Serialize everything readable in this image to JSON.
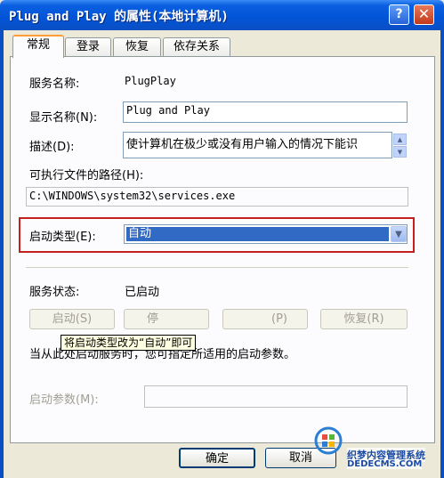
{
  "window": {
    "title": "Plug and Play 的属性(本地计算机)",
    "help_label": "?",
    "close_label": "✕"
  },
  "tabs": [
    {
      "label": "常规",
      "active": true
    },
    {
      "label": "登录",
      "active": false
    },
    {
      "label": "恢复",
      "active": false
    },
    {
      "label": "依存关系",
      "active": false
    }
  ],
  "general": {
    "service_name_label": "服务名称:",
    "service_name_value": "PlugPlay",
    "display_name_label": "显示名称(N):",
    "display_name_value": "Plug and Play",
    "description_label": "描述(D):",
    "description_value": "使计算机在极少或没有用户输入的情况下能识",
    "path_label": "可执行文件的路径(H):",
    "path_value": "C:\\WINDOWS\\system32\\services.exe",
    "startup_type_label": "启动类型(E):",
    "startup_type_value": "自动",
    "status_label": "服务状态:",
    "status_value": "已启动",
    "start_button": "启动(S)",
    "stop_button": "停",
    "pause_button": "(P)",
    "resume_button": "恢复(R)",
    "hint_text": "当从此处启动服务时，您可指定所适用的启动参数。",
    "params_label": "启动参数(M):",
    "params_value": ""
  },
  "tooltip": {
    "text": "将启动类型改为“自动”即可"
  },
  "footer": {
    "ok_button": "确定",
    "cancel_button": "取消"
  },
  "watermark": {
    "text": "织梦内容管理系统",
    "url": "DEDECMS.COM"
  }
}
